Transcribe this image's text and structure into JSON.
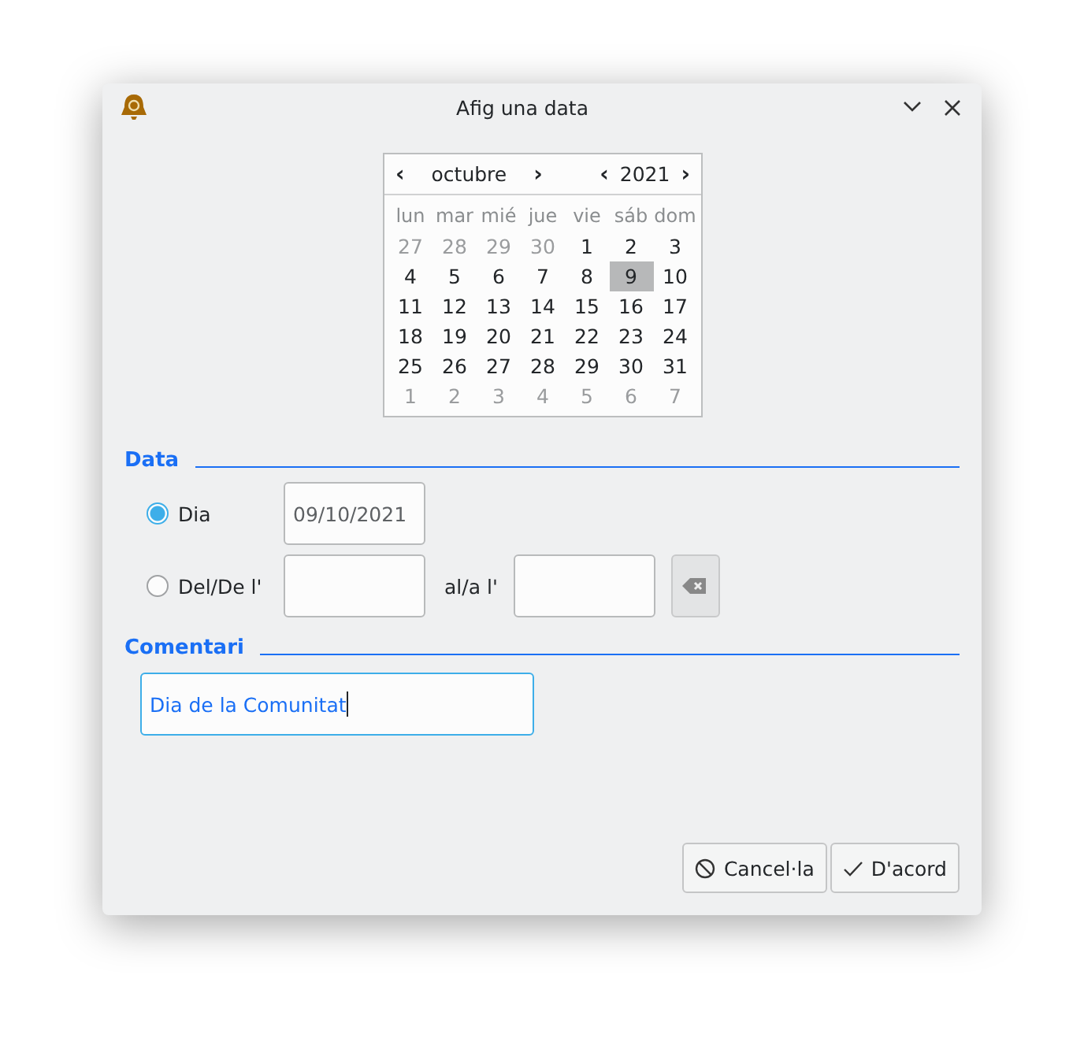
{
  "window": {
    "title": "Afig una data"
  },
  "calendar": {
    "month": "octubre",
    "year": "2021",
    "prev_month": "‹",
    "next_month": "›",
    "prev_year": "‹",
    "next_year": "›",
    "weekdays": [
      "lun",
      "mar",
      "mié",
      "jue",
      "vie",
      "sáb",
      "dom"
    ],
    "weeks": [
      [
        {
          "day": "27",
          "other_month": true,
          "selected": false
        },
        {
          "day": "28",
          "other_month": true,
          "selected": false
        },
        {
          "day": "29",
          "other_month": true,
          "selected": false
        },
        {
          "day": "30",
          "other_month": true,
          "selected": false
        },
        {
          "day": "1",
          "other_month": false,
          "selected": false
        },
        {
          "day": "2",
          "other_month": false,
          "selected": false
        },
        {
          "day": "3",
          "other_month": false,
          "selected": false
        }
      ],
      [
        {
          "day": "4",
          "other_month": false,
          "selected": false
        },
        {
          "day": "5",
          "other_month": false,
          "selected": false
        },
        {
          "day": "6",
          "other_month": false,
          "selected": false
        },
        {
          "day": "7",
          "other_month": false,
          "selected": false
        },
        {
          "day": "8",
          "other_month": false,
          "selected": false
        },
        {
          "day": "9",
          "other_month": false,
          "selected": true
        },
        {
          "day": "10",
          "other_month": false,
          "selected": false
        }
      ],
      [
        {
          "day": "11",
          "other_month": false,
          "selected": false
        },
        {
          "day": "12",
          "other_month": false,
          "selected": false
        },
        {
          "day": "13",
          "other_month": false,
          "selected": false
        },
        {
          "day": "14",
          "other_month": false,
          "selected": false
        },
        {
          "day": "15",
          "other_month": false,
          "selected": false
        },
        {
          "day": "16",
          "other_month": false,
          "selected": false
        },
        {
          "day": "17",
          "other_month": false,
          "selected": false
        }
      ],
      [
        {
          "day": "18",
          "other_month": false,
          "selected": false
        },
        {
          "day": "19",
          "other_month": false,
          "selected": false
        },
        {
          "day": "20",
          "other_month": false,
          "selected": false
        },
        {
          "day": "21",
          "other_month": false,
          "selected": false
        },
        {
          "day": "22",
          "other_month": false,
          "selected": false
        },
        {
          "day": "23",
          "other_month": false,
          "selected": false
        },
        {
          "day": "24",
          "other_month": false,
          "selected": false
        }
      ],
      [
        {
          "day": "25",
          "other_month": false,
          "selected": false
        },
        {
          "day": "26",
          "other_month": false,
          "selected": false
        },
        {
          "day": "27",
          "other_month": false,
          "selected": false
        },
        {
          "day": "28",
          "other_month": false,
          "selected": false
        },
        {
          "day": "29",
          "other_month": false,
          "selected": false
        },
        {
          "day": "30",
          "other_month": false,
          "selected": false
        },
        {
          "day": "31",
          "other_month": false,
          "selected": false
        }
      ],
      [
        {
          "day": "1",
          "other_month": true,
          "selected": false
        },
        {
          "day": "2",
          "other_month": true,
          "selected": false
        },
        {
          "day": "3",
          "other_month": true,
          "selected": false
        },
        {
          "day": "4",
          "other_month": true,
          "selected": false
        },
        {
          "day": "5",
          "other_month": true,
          "selected": false
        },
        {
          "day": "6",
          "other_month": true,
          "selected": false
        },
        {
          "day": "7",
          "other_month": true,
          "selected": false
        }
      ]
    ]
  },
  "data_section": {
    "heading": "Data",
    "single": {
      "label": "Dia",
      "selected": true,
      "value": "09/10/2021"
    },
    "range": {
      "label": "Del/De l'",
      "selected": false,
      "to_label": "al/a l'"
    }
  },
  "comment_section": {
    "heading": "Comentari",
    "value": "Dia de la Comunitat"
  },
  "buttons": [
    {
      "label": "Cancel·la",
      "kind": "cancel"
    },
    {
      "label": "D'acord",
      "kind": "ok"
    }
  ]
}
